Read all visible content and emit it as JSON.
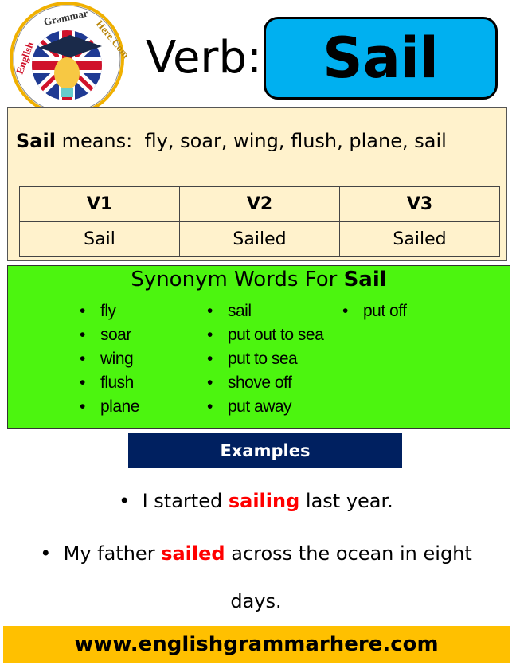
{
  "logo": {
    "text": "English Grammar Here.Com",
    "icon": "graduation-lightbulb-uk-flag-logo"
  },
  "header": {
    "label": "Verb:",
    "word": "Sail"
  },
  "meaning": {
    "word": "Sail",
    "label": "means:",
    "synonyms_text": "fly, soar, wing, flush, plane, sail"
  },
  "forms": {
    "headers": [
      "V1",
      "V2",
      "V3"
    ],
    "values": [
      "Sail",
      "Sailed",
      "Sailed"
    ]
  },
  "synonyms": {
    "title_prefix": "Synonym Words For",
    "title_word": "Sail",
    "columns": [
      [
        "fly",
        "soar",
        "wing",
        "flush",
        "plane"
      ],
      [
        "sail",
        "put out to sea",
        "put to sea",
        "shove off",
        "put away"
      ],
      [
        "put off"
      ]
    ]
  },
  "examples": {
    "title": "Examples",
    "items": [
      {
        "before": "I started",
        "highlight": "sailing",
        "after": "last year."
      },
      {
        "before": "My father",
        "highlight": "sailed",
        "after": "across the ocean in eight",
        "after2": "days."
      }
    ]
  },
  "footer": {
    "url": "www.englishgrammarhere.com"
  },
  "colors": {
    "blue": "#00b0f0",
    "cream": "#fff2cc",
    "green": "#4cf50f",
    "navy": "#002060",
    "highlight": "#ff0000",
    "footer": "#ffc000"
  }
}
